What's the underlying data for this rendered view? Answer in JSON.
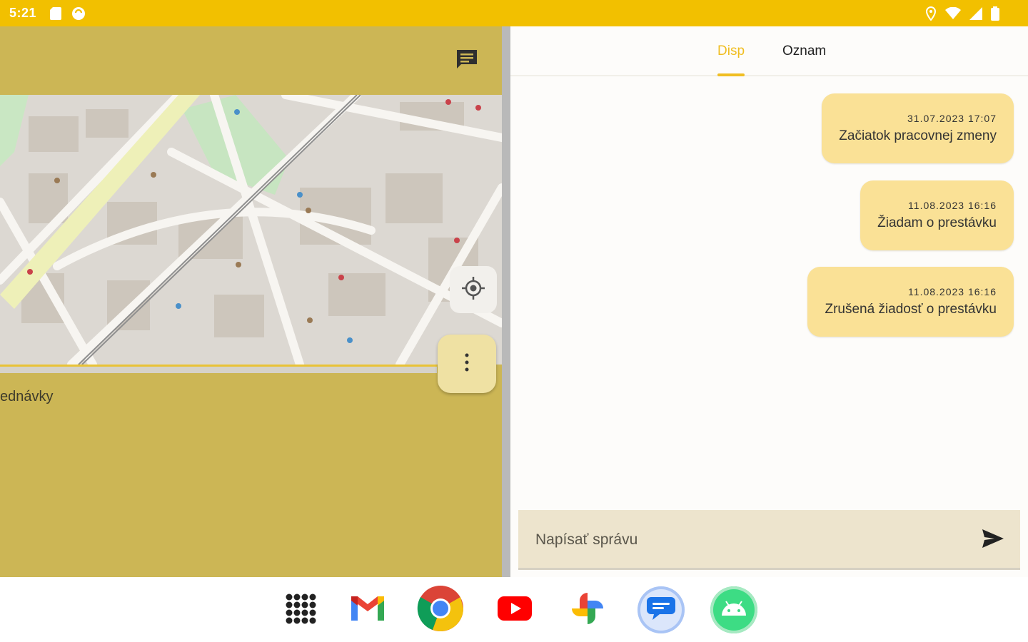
{
  "status_bar": {
    "time": "5:21"
  },
  "tabs": [
    {
      "label": "Disp"
    },
    {
      "label": "Oznam"
    }
  ],
  "messages": [
    {
      "timestamp": "31.07.2023 17:07",
      "text": "Začiatok pracovnej zmeny"
    },
    {
      "timestamp": "11.08.2023 16:16",
      "text": "Žiadam o prestávku"
    },
    {
      "timestamp": "11.08.2023 16:16",
      "text": "Zrušená žiadosť o prestávku"
    }
  ],
  "composer": {
    "placeholder": "Napísať správu"
  },
  "left_pane": {
    "label": "ednávky"
  },
  "colors": {
    "accent": "#f2c000",
    "panel": "#ccb655",
    "bubble": "#fae196"
  }
}
